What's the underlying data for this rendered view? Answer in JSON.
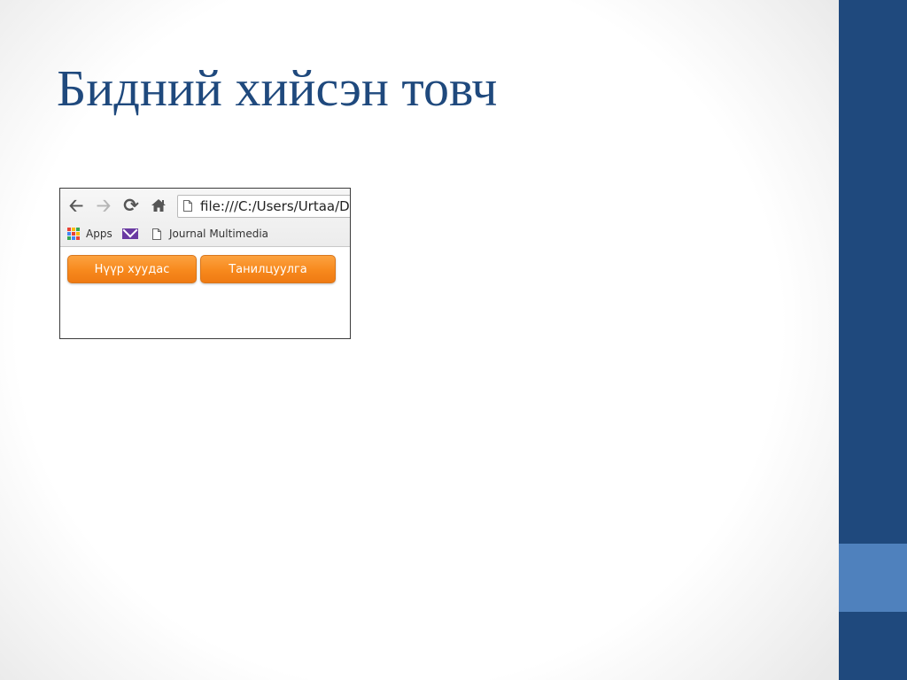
{
  "slide": {
    "title": "Бидний хийсэн товч"
  },
  "browser": {
    "address": "file:///C:/Users/Urtaa/D",
    "bookmarks": [
      {
        "label": "Apps",
        "icon": "apps-grid-icon"
      },
      {
        "label": "",
        "icon": "mail-icon"
      },
      {
        "label": "Journal Multimedia",
        "icon": "page-icon"
      }
    ],
    "nav_icons": [
      "back-arrow-icon",
      "forward-arrow-icon",
      "reload-icon",
      "home-icon"
    ]
  },
  "buttons": {
    "home": "Нүүр хуудас",
    "intro": "Танилцуулга"
  },
  "colors": {
    "title": "#1f497d",
    "band": "#1f497d",
    "band_accent": "#4f81bd",
    "button": "#f7891d"
  }
}
